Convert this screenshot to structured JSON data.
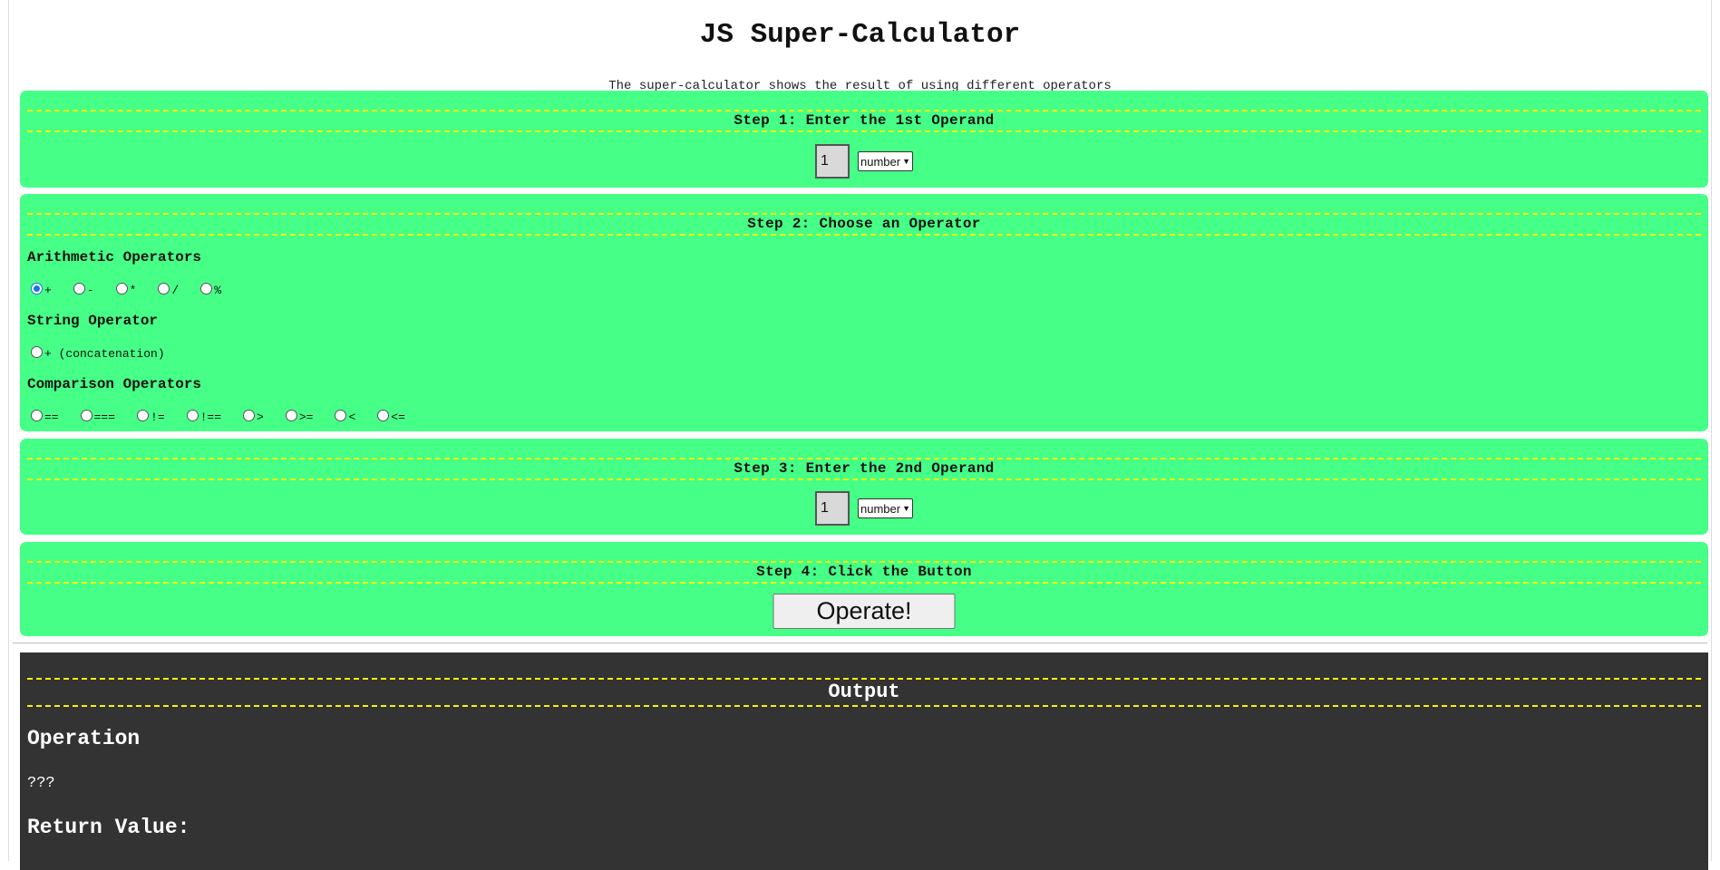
{
  "header": {
    "title": "JS Super-Calculator",
    "subtitle": "The super-calculator shows the result of using different operators"
  },
  "step1": {
    "heading": "Step 1: Enter the 1st Operand",
    "value": "1",
    "type": "number"
  },
  "step2": {
    "heading": "Step 2: Choose an Operator",
    "arithmetic_label": "Arithmetic Operators",
    "arithmetic": [
      "+",
      "-",
      "*",
      "/",
      "%"
    ],
    "string_label": "String Operator",
    "string": [
      "+ (concatenation)"
    ],
    "comparison_label": "Comparison Operators",
    "comparison": [
      "==",
      "===",
      "!=",
      "!==",
      ">",
      ">=",
      "<",
      "<="
    ],
    "selected": "+"
  },
  "step3": {
    "heading": "Step 3: Enter the 2nd Operand",
    "value": "1",
    "type": "number"
  },
  "step4": {
    "heading": "Step 4: Click the Button",
    "button_label": "Operate!"
  },
  "output": {
    "heading": "Output",
    "operation_label": "Operation",
    "operation_value": "???",
    "return_label": "Return Value:"
  },
  "colors": {
    "panel": "#46ff87",
    "dash": "#f4f40a",
    "output_bg": "#333333"
  }
}
